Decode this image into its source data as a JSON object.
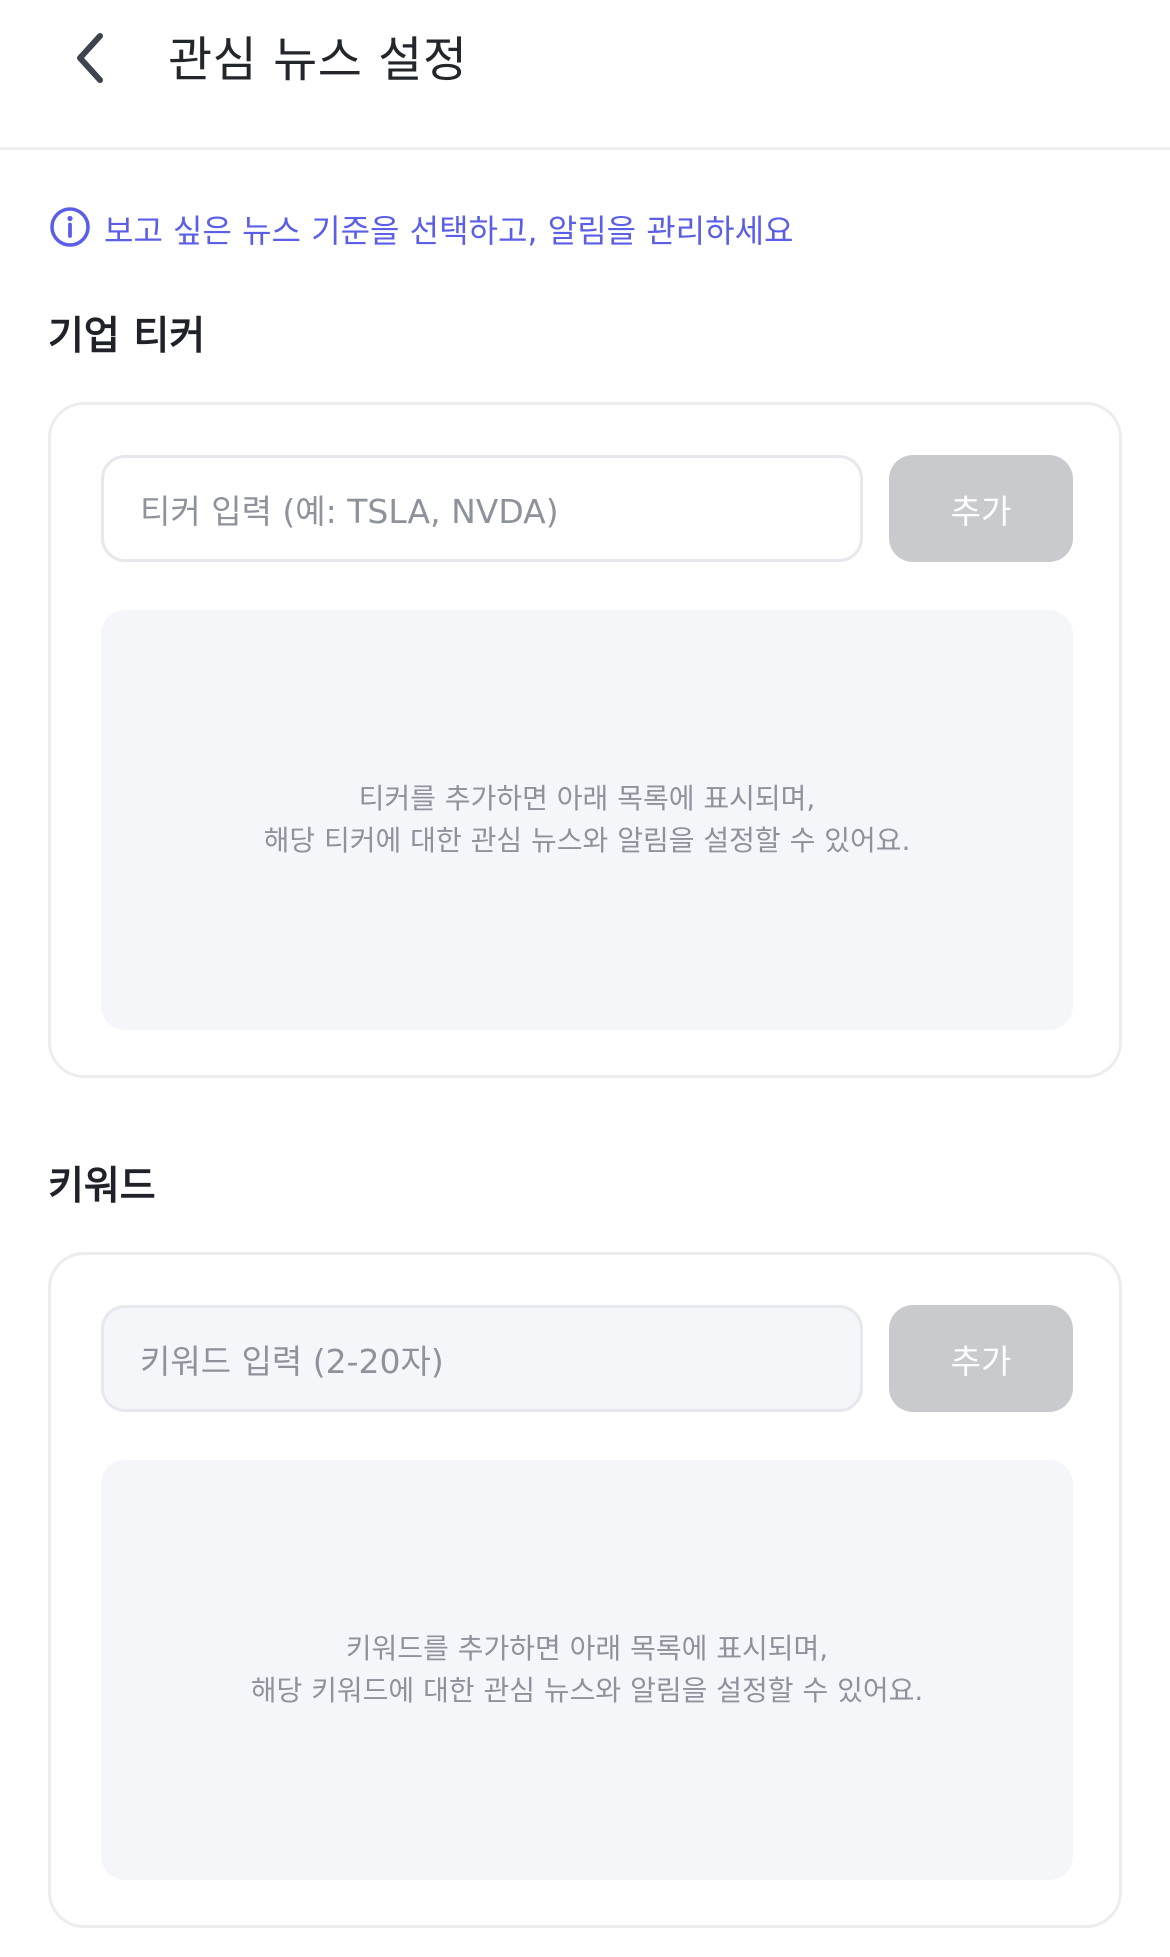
{
  "header": {
    "title": "관심 뉴스 설정",
    "back_icon": "chevron-left-icon"
  },
  "info": {
    "icon": "info-circle-icon",
    "text": "보고 싶은 뉴스 기준을 선택하고, 알림을 관리하세요",
    "color": "#5b5ee6"
  },
  "ticker_section": {
    "title": "기업 티커",
    "input_placeholder": "티커 입력 (예: TSLA, NVDA)",
    "add_label": "추가",
    "empty_line1": "티커를 추가하면 아래 목록에 표시되며,",
    "empty_line2": "해당 티커에 대한 관심 뉴스와 알림을 설정할 수 있어요."
  },
  "keyword_section": {
    "title": "키워드",
    "input_placeholder": "키워드 입력 (2-20자)",
    "add_label": "추가",
    "empty_line1": "키워드를 추가하면 아래 목록에 표시되며,",
    "empty_line2": "해당 키워드에 대한 관심 뉴스와 알림을 설정할 수 있어요."
  },
  "colors": {
    "accent": "#5b5ee6",
    "button_disabled": "#c8cace",
    "panel_bg": "#f5f6fa"
  }
}
